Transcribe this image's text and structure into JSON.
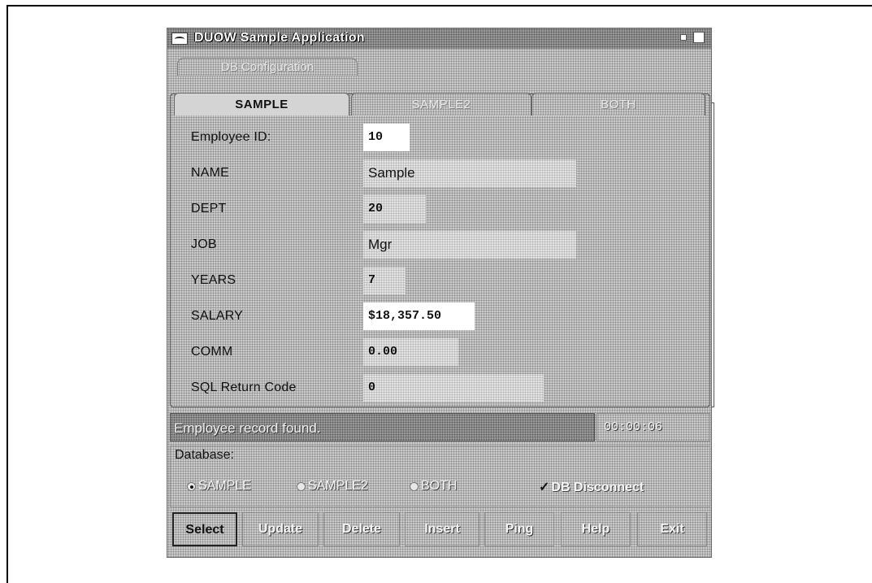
{
  "window": {
    "title": "DUOW Sample Application"
  },
  "config_tab": {
    "label": "DB Configuration"
  },
  "tabs": [
    {
      "label": "SAMPLE"
    },
    {
      "label": "SAMPLE2"
    },
    {
      "label": "BOTH"
    }
  ],
  "fields": {
    "employee_id": {
      "label": "Employee ID:",
      "value": "10"
    },
    "name": {
      "label": "NAME",
      "value": "Sample"
    },
    "dept": {
      "label": "DEPT",
      "value": "20"
    },
    "job": {
      "label": "JOB",
      "value": "Mgr"
    },
    "years": {
      "label": "YEARS",
      "value": "7"
    },
    "salary": {
      "label": "SALARY",
      "value": "$18,357.50"
    },
    "comm": {
      "label": "COMM",
      "value": "0.00"
    },
    "sql_code": {
      "label": "SQL Return Code",
      "value": "0"
    }
  },
  "status": {
    "message": "Employee record found.",
    "time": "00:00:06"
  },
  "database": {
    "label": "Database:",
    "options": [
      "SAMPLE",
      "SAMPLE2",
      "BOTH"
    ],
    "selected": "SAMPLE",
    "disconnect_label": "DB Disconnect",
    "disconnect_checked": true
  },
  "buttons": {
    "select": "Select",
    "update": "Update",
    "delete": "Delete",
    "insert": "Insert",
    "ping": "Ping",
    "help": "Help",
    "exit": "Exit"
  }
}
